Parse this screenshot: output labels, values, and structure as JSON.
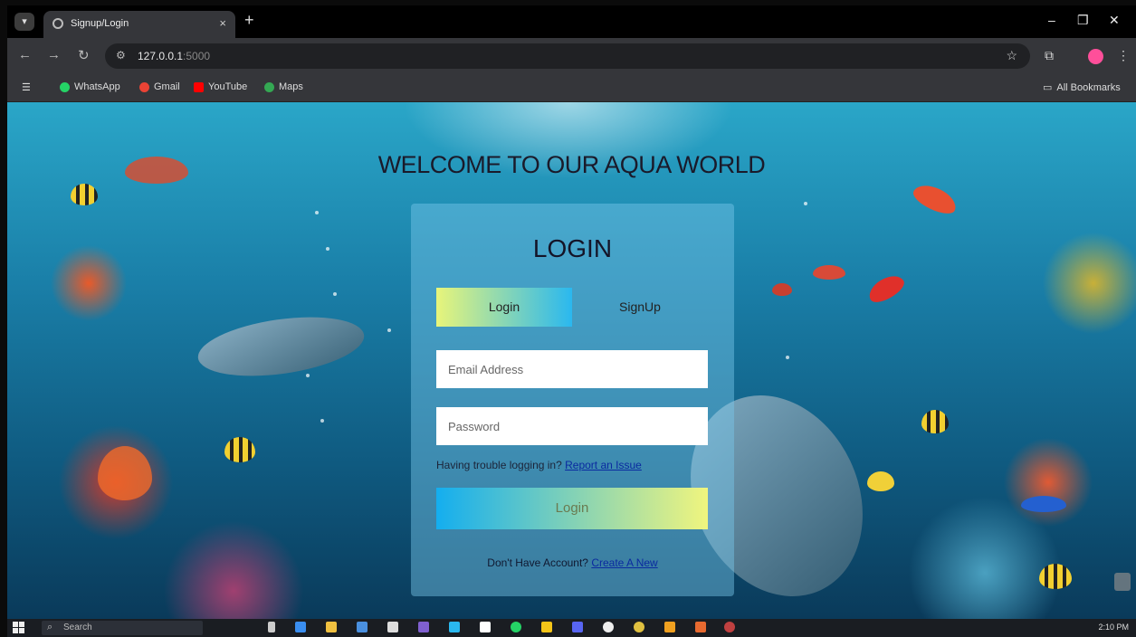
{
  "browser": {
    "tab_title": "Signup/Login",
    "tab_close": "×",
    "new_tab": "+",
    "url_host": "127.0.0.1",
    "url_rest": ":5000",
    "window_controls": [
      "–",
      "❐",
      "✕"
    ]
  },
  "bookmarks": {
    "items": [
      {
        "label": "WhatsApp",
        "color": "#25d366"
      },
      {
        "label": "Gmail",
        "color": "#ea4335"
      },
      {
        "label": "YouTube",
        "color": "#ff0000"
      },
      {
        "label": "Maps",
        "color": "#34a853"
      }
    ],
    "all_bookmarks": "All Bookmarks"
  },
  "page": {
    "welcome": "WELCOME TO OUR AQUA WORLD",
    "card_title": "LOGIN",
    "tabs": {
      "login": "Login",
      "signup": "SignUp"
    },
    "email_placeholder": "Email Address",
    "password_placeholder": "Password",
    "help_text": "Having trouble logging in?",
    "help_link": "Report an Issue",
    "submit": "Login",
    "create_text": "Don't Have Account?",
    "create_link": "Create A New"
  },
  "taskbar": {
    "search_placeholder": "Search",
    "time": "2:10 PM"
  },
  "colors": {
    "accent_yellow": "#e8f57a",
    "accent_blue": "#2ab8ef",
    "link": "#0a2aa0"
  }
}
